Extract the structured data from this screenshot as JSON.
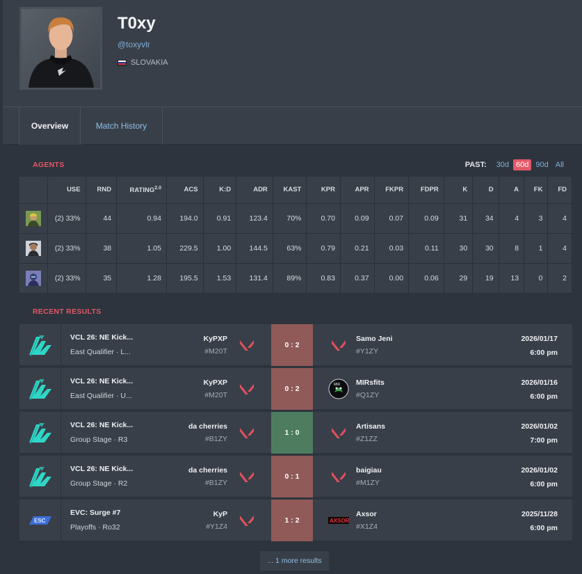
{
  "profile": {
    "name": "T0xy",
    "handle": "@toxyvlr",
    "country": "SLOVAKIA"
  },
  "tabs": [
    {
      "label": "Overview",
      "active": true
    },
    {
      "label": "Match History",
      "active": false
    }
  ],
  "agents_section": {
    "title": "AGENTS",
    "past_label": "PAST:",
    "past_options": [
      "30d",
      "60d",
      "90d",
      "All"
    ],
    "past_selected": "60d",
    "columns": [
      "USE",
      "RND",
      "RATING",
      "ACS",
      "K:D",
      "ADR",
      "KAST",
      "KPR",
      "APR",
      "FKPR",
      "FDPR",
      "K",
      "D",
      "A",
      "FK",
      "FD"
    ],
    "rating_sup": "2.0",
    "rows": [
      {
        "agent_icon": "agent-icon-1",
        "cells": [
          "(2) 33%",
          "44",
          "0.94",
          "194.0",
          "0.91",
          "123.4",
          "70%",
          "0.70",
          "0.09",
          "0.07",
          "0.09",
          "31",
          "34",
          "4",
          "3",
          "4"
        ]
      },
      {
        "agent_icon": "agent-icon-2",
        "cells": [
          "(2) 33%",
          "38",
          "1.05",
          "229.5",
          "1.00",
          "144.5",
          "63%",
          "0.79",
          "0.21",
          "0.03",
          "0.11",
          "30",
          "30",
          "8",
          "1",
          "4"
        ]
      },
      {
        "agent_icon": "agent-icon-3",
        "cells": [
          "(2) 33%",
          "35",
          "1.28",
          "195.5",
          "1.53",
          "131.4",
          "89%",
          "0.83",
          "0.37",
          "0.00",
          "0.06",
          "29",
          "19",
          "13",
          "0",
          "2"
        ]
      }
    ]
  },
  "results_section": {
    "title": "RECENT RESULTS",
    "matches": [
      {
        "event": "VCL 26: NE Kick...",
        "sub": "East Qualifier · L...",
        "team1": "KyPXP",
        "tag1": "#M20T",
        "score": "0 : 2",
        "result": "loss",
        "team2": "Samo Jeni",
        "tag2": "#Y1ZY",
        "date": "2026/01/17",
        "time": "6:00 pm",
        "opp_logo": "valorant"
      },
      {
        "event": "VCL 26: NE Kick...",
        "sub": "East Qualifier · U...",
        "team1": "KyPXP",
        "tag1": "#M20T",
        "score": "0 : 2",
        "result": "loss",
        "team2": "MIRsfits",
        "tag2": "#Q1ZY",
        "date": "2026/01/16",
        "time": "6:00 pm",
        "opp_logo": "mirsfits"
      },
      {
        "event": "VCL 26: NE Kick...",
        "sub": "Group Stage · R3",
        "team1": "da cherries",
        "tag1": "#B1ZY",
        "score": "1 : 0",
        "result": "win",
        "team2": "Artisans",
        "tag2": "#Z1ZZ",
        "date": "2026/01/02",
        "time": "7:00 pm",
        "opp_logo": "valorant"
      },
      {
        "event": "VCL 26: NE Kick...",
        "sub": "Group Stage · R2",
        "team1": "da cherries",
        "tag1": "#B1ZY",
        "score": "0 : 1",
        "result": "loss",
        "team2": "baigiau",
        "tag2": "#M1ZY",
        "date": "2026/01/02",
        "time": "6:00 pm",
        "opp_logo": "valorant"
      },
      {
        "event": "EVC: Surge #7",
        "sub": "Playoffs · Ro32",
        "team1": "KyP",
        "tag1": "#Y1Z4",
        "score": "1 : 2",
        "result": "loss",
        "team2": "Axsor",
        "tag2": "#X1Z4",
        "date": "2025/11/28",
        "time": "6:00 pm",
        "opp_logo": "axsor"
      }
    ],
    "more_results": "... 1 more results"
  },
  "colors": {
    "accent_red": "#e25866",
    "link_blue": "#7fb0d9",
    "panel": "#393f48",
    "page": "#2e343d",
    "loss": "#8f5a58",
    "win": "#4d7d5e",
    "valorant_red": "#e0505e",
    "vcl_cyan": "#2fd6c7"
  }
}
